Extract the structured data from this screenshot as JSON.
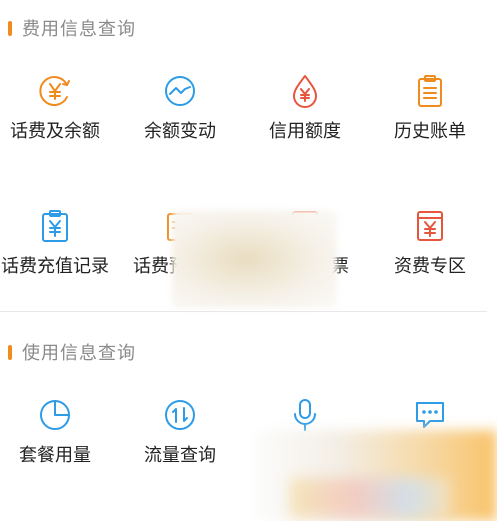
{
  "sections": [
    {
      "title": "费用信息查询",
      "items": [
        {
          "label": "话费及余额",
          "icon": "yen-coin-icon",
          "color": "#f08c1e"
        },
        {
          "label": "余额变动",
          "icon": "trend-circle-icon",
          "color": "#2d9be6"
        },
        {
          "label": "信用额度",
          "icon": "yen-drop-icon",
          "color": "#e6553c"
        },
        {
          "label": "历史账单",
          "icon": "clipboard-list-icon",
          "color": "#f08c1e"
        },
        {
          "label": "话费充值记录",
          "icon": "yen-clipboard-icon",
          "color": "#2d9be6"
        },
        {
          "label": "话费预",
          "icon": "receipt-icon",
          "color": "#f08c1e"
        },
        {
          "label": "票",
          "icon": "invoice-icon",
          "color": "#e6553c"
        },
        {
          "label": "资费专区",
          "icon": "yen-document-icon",
          "color": "#e6553c"
        }
      ]
    },
    {
      "title": "使用信息查询",
      "items": [
        {
          "label": "套餐用量",
          "icon": "pie-chart-icon",
          "color": "#2d9be6"
        },
        {
          "label": "流量查询",
          "icon": "data-arrows-icon",
          "color": "#2d9be6"
        },
        {
          "label": "",
          "icon": "microphone-icon",
          "color": "#2d9be6"
        },
        {
          "label": "",
          "icon": "message-icon",
          "color": "#2d9be6"
        }
      ]
    }
  ]
}
